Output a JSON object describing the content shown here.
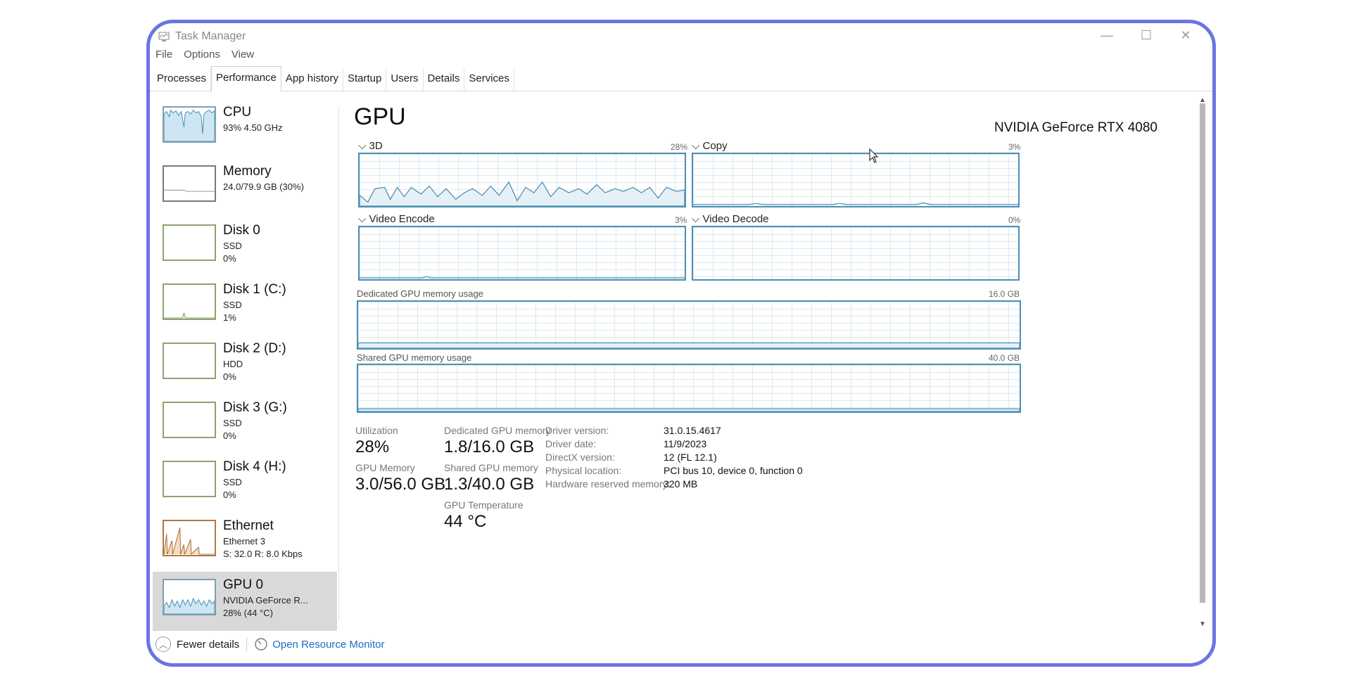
{
  "window": {
    "title": "Task Manager",
    "controls": [
      "—",
      "☐",
      "✕"
    ]
  },
  "menu": [
    "File",
    "Options",
    "View"
  ],
  "tabs": [
    "Processes",
    "Performance",
    "App history",
    "Startup",
    "Users",
    "Details",
    "Services"
  ],
  "active_tab": "Performance",
  "sidebar": {
    "items": [
      {
        "name": "CPU",
        "sub": "93% 4.50 GHz"
      },
      {
        "name": "Memory",
        "sub": "24.0/79.9 GB (30%)"
      },
      {
        "name": "Disk 0",
        "sub": "SSD\n0%"
      },
      {
        "name": "Disk 1 (C:)",
        "sub": "SSD\n1%"
      },
      {
        "name": "Disk 2 (D:)",
        "sub": "HDD\n0%"
      },
      {
        "name": "Disk 3 (G:)",
        "sub": "SSD\n0%"
      },
      {
        "name": "Disk 4 (H:)",
        "sub": "SSD\n0%"
      },
      {
        "name": "Ethernet",
        "sub": "Ethernet 3\nS: 32.0 R: 8.0 Kbps"
      },
      {
        "name": "GPU 0",
        "sub": "NVIDIA GeForce R...\n28% (44 °C)"
      }
    ]
  },
  "main": {
    "title": "GPU",
    "model": "NVIDIA GeForce RTX 4080",
    "engines": [
      {
        "label": "3D",
        "pct": "28%"
      },
      {
        "label": "Copy",
        "pct": "3%"
      },
      {
        "label": "Video Encode",
        "pct": "3%"
      },
      {
        "label": "Video Decode",
        "pct": "0%"
      }
    ],
    "dedicated_label": "Dedicated GPU memory usage",
    "dedicated_max": "16.0 GB",
    "shared_label": "Shared GPU memory usage",
    "shared_max": "40.0 GB",
    "stats": {
      "utilization_label": "Utilization",
      "utilization": "28%",
      "gpu_memory_label": "GPU Memory",
      "gpu_memory": "3.0/56.0 GB",
      "dedicated_label": "Dedicated GPU memory",
      "dedicated": "1.8/16.0 GB",
      "shared_label": "Shared GPU memory",
      "shared": "1.3/40.0 GB",
      "temp_label": "GPU Temperature",
      "temp": "44 °C"
    },
    "details": [
      {
        "k": "Driver version:",
        "v": "31.0.15.4617"
      },
      {
        "k": "Driver date:",
        "v": "11/9/2023"
      },
      {
        "k": "DirectX version:",
        "v": "12 (FL 12.1)"
      },
      {
        "k": "Physical location:",
        "v": "PCI bus 10, device 0, function 0"
      },
      {
        "k": "Hardware reserved memory:",
        "v": "320 MB"
      }
    ]
  },
  "footer": {
    "fewer_details": "Fewer details",
    "resource_monitor": "Open Resource Monitor"
  },
  "colors": {
    "gpu_line": "#4c8fb5",
    "frame": "#6b74e3",
    "link": "#1b6cc4"
  }
}
